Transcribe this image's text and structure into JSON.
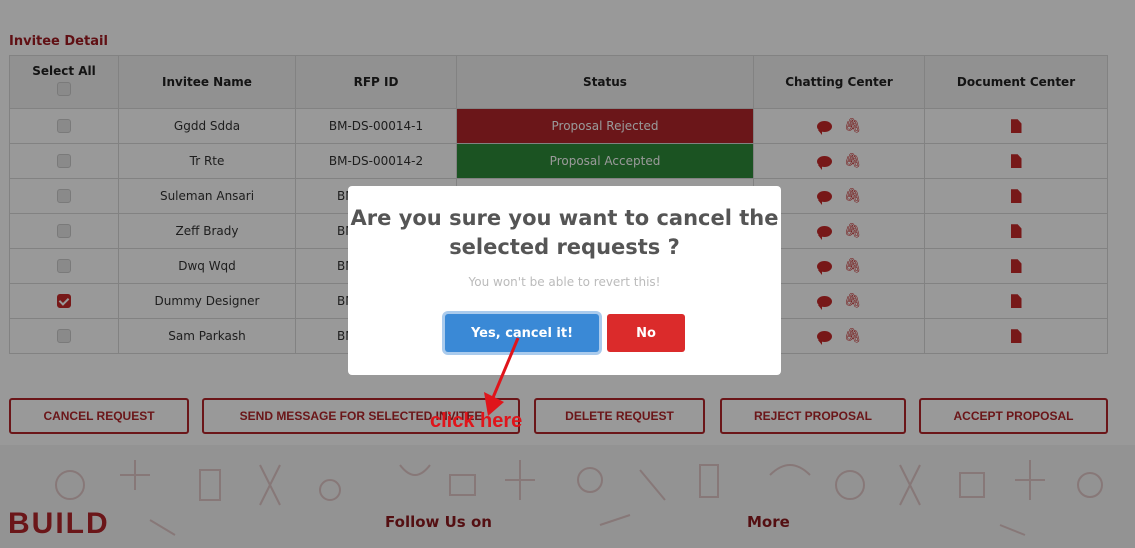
{
  "section_title": "Invitee Detail",
  "table": {
    "headers": {
      "select_all": "Select All",
      "invitee_name": "Invitee Name",
      "rfp_id": "RFP ID",
      "status": "Status",
      "chatting_center": "Chatting Center",
      "document_center": "Document Center"
    },
    "rows": [
      {
        "name": "Ggdd Sdda",
        "rfp_id": "BM-DS-00014-1",
        "status": "Proposal Rejected",
        "status_color": "#b3262b",
        "checked": false
      },
      {
        "name": "Tr Rte",
        "rfp_id": "BM-DS-00014-2",
        "status": "Proposal Accepted",
        "status_color": "#2e8b3a",
        "checked": false
      },
      {
        "name": "Suleman Ansari",
        "rfp_id": "BM",
        "status": "",
        "status_color": "",
        "checked": false
      },
      {
        "name": "Zeff Brady",
        "rfp_id": "BM",
        "status": "",
        "status_color": "",
        "checked": false
      },
      {
        "name": "Dwq Wqd",
        "rfp_id": "BM",
        "status": "",
        "status_color": "",
        "checked": false
      },
      {
        "name": "Dummy Designer",
        "rfp_id": "BM",
        "status": "",
        "status_color": "",
        "checked": true
      },
      {
        "name": "Sam Parkash",
        "rfp_id": "BM",
        "status": "",
        "status_color": "",
        "checked": false
      }
    ],
    "icons": {
      "chat": "chat-bubble-icon",
      "attach": "paperclip-icon",
      "document": "document-icon"
    }
  },
  "actions": {
    "cancel_request": "CANCEL REQUEST",
    "send_message": "SEND MESSAGE FOR SELECTED INVITEE",
    "delete_request": "DELETE REQUEST",
    "reject_proposal": "REJECT PROPOSAL",
    "accept_proposal": "ACCEPT PROPOSAL"
  },
  "footer": {
    "logo": "BUILD",
    "follow_us": "Follow Us on",
    "more": "More"
  },
  "modal": {
    "title": "Are you sure you want to cancel the selected requests ?",
    "subtitle": "You won't be able to revert this!",
    "confirm_label": "Yes, cancel it!",
    "cancel_label": "No"
  },
  "annotation": {
    "text": "click here"
  },
  "colors": {
    "brand": "#b3262b",
    "rejected": "#b3262b",
    "accepted": "#2e8b3a",
    "confirm": "#3a89d6",
    "no": "#db2b2b"
  }
}
